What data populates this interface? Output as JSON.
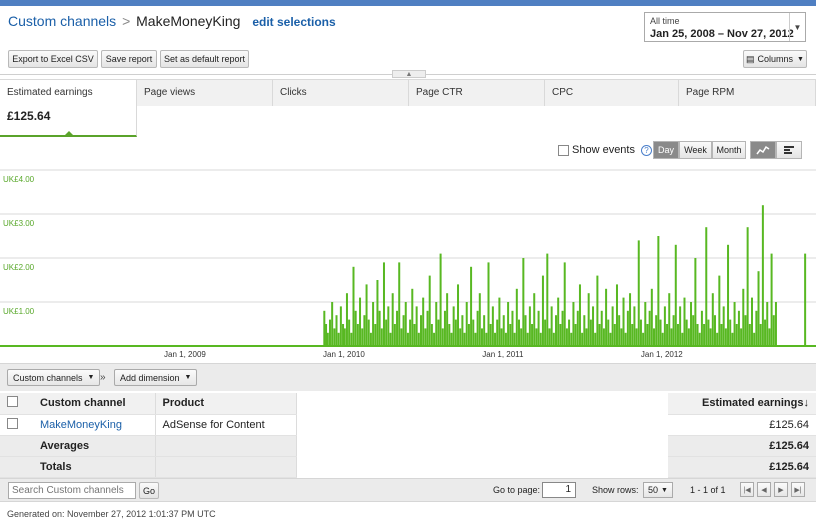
{
  "breadcrumb": {
    "root": "Custom channels",
    "separator": ">",
    "current": "MakeMoneyKing",
    "edit": "edit selections"
  },
  "date_range": {
    "label": "All time",
    "value": "Jan 25, 2008 – Nov 27, 2012"
  },
  "toolbar": {
    "export": "Export to Excel CSV",
    "save": "Save report",
    "default": "Set as default report",
    "columns": "Columns"
  },
  "metrics": [
    {
      "label": "Estimated earnings",
      "value": "£125.64"
    },
    {
      "label": "Page views",
      "value": ""
    },
    {
      "label": "Clicks",
      "value": ""
    },
    {
      "label": "Page CTR",
      "value": ""
    },
    {
      "label": "CPC",
      "value": ""
    },
    {
      "label": "Page RPM",
      "value": ""
    }
  ],
  "chart_controls": {
    "show_events": "Show events",
    "help": "?",
    "granularity": [
      "Day",
      "Week",
      "Month"
    ],
    "selected_granularity": "Day"
  },
  "chart_data": {
    "type": "bar",
    "y_ticks": [
      "UK£4.00",
      "UK£3.00",
      "UK£2.00",
      "UK£1.00"
    ],
    "ylim": [
      0,
      4
    ],
    "x_ticks": [
      "Jan 1, 2009",
      "Jan 1, 2010",
      "Jan 1, 2011",
      "Jan 1, 2012"
    ],
    "x_range": [
      "2008-01-25",
      "2012-11-27"
    ],
    "grid": true,
    "series": [
      {
        "color": "#58b822",
        "points": [
          [
            "2009-11-17",
            0.8
          ],
          [
            "2009-11-21",
            0.5
          ],
          [
            "2009-11-25",
            0.3
          ],
          [
            "2009-11-30",
            0.6
          ],
          [
            "2009-12-05",
            1.0
          ],
          [
            "2009-12-10",
            0.4
          ],
          [
            "2009-12-15",
            0.7
          ],
          [
            "2009-12-20",
            0.3
          ],
          [
            "2009-12-25",
            0.9
          ],
          [
            "2009-12-30",
            0.5
          ],
          [
            "2010-01-03",
            0.4
          ],
          [
            "2010-01-08",
            1.2
          ],
          [
            "2010-01-13",
            0.6
          ],
          [
            "2010-01-18",
            0.3
          ],
          [
            "2010-01-23",
            1.8
          ],
          [
            "2010-01-28",
            0.8
          ],
          [
            "2010-02-02",
            0.5
          ],
          [
            "2010-02-07",
            1.1
          ],
          [
            "2010-02-12",
            0.4
          ],
          [
            "2010-02-17",
            0.7
          ],
          [
            "2010-02-22",
            1.4
          ],
          [
            "2010-02-27",
            0.6
          ],
          [
            "2010-03-04",
            0.3
          ],
          [
            "2010-03-09",
            1.0
          ],
          [
            "2010-03-14",
            0.5
          ],
          [
            "2010-03-19",
            1.5
          ],
          [
            "2010-03-24",
            0.8
          ],
          [
            "2010-03-29",
            0.4
          ],
          [
            "2010-04-03",
            1.9
          ],
          [
            "2010-04-08",
            0.6
          ],
          [
            "2010-04-13",
            0.9
          ],
          [
            "2010-04-18",
            0.3
          ],
          [
            "2010-04-23",
            1.2
          ],
          [
            "2010-04-28",
            0.5
          ],
          [
            "2010-05-03",
            0.8
          ],
          [
            "2010-05-08",
            1.9
          ],
          [
            "2010-05-13",
            0.4
          ],
          [
            "2010-05-18",
            0.7
          ],
          [
            "2010-05-23",
            1.0
          ],
          [
            "2010-05-28",
            0.3
          ],
          [
            "2010-06-02",
            0.6
          ],
          [
            "2010-06-07",
            1.3
          ],
          [
            "2010-06-12",
            0.5
          ],
          [
            "2010-06-17",
            0.9
          ],
          [
            "2010-06-22",
            0.3
          ],
          [
            "2010-06-27",
            0.7
          ],
          [
            "2010-07-02",
            1.1
          ],
          [
            "2010-07-07",
            0.4
          ],
          [
            "2010-07-12",
            0.8
          ],
          [
            "2010-07-17",
            1.6
          ],
          [
            "2010-07-22",
            0.5
          ],
          [
            "2010-07-27",
            0.3
          ],
          [
            "2010-08-01",
            1.0
          ],
          [
            "2010-08-06",
            0.6
          ],
          [
            "2010-08-11",
            2.1
          ],
          [
            "2010-08-16",
            0.4
          ],
          [
            "2010-08-21",
            0.8
          ],
          [
            "2010-08-26",
            1.2
          ],
          [
            "2010-08-31",
            0.5
          ],
          [
            "2010-09-05",
            0.3
          ],
          [
            "2010-09-10",
            0.9
          ],
          [
            "2010-09-15",
            0.6
          ],
          [
            "2010-09-20",
            1.4
          ],
          [
            "2010-09-25",
            0.4
          ],
          [
            "2010-09-30",
            0.7
          ],
          [
            "2010-10-05",
            0.3
          ],
          [
            "2010-10-10",
            1.0
          ],
          [
            "2010-10-15",
            0.5
          ],
          [
            "2010-10-20",
            1.8
          ],
          [
            "2010-10-25",
            0.6
          ],
          [
            "2010-10-30",
            0.3
          ],
          [
            "2010-11-04",
            0.8
          ],
          [
            "2010-11-09",
            1.2
          ],
          [
            "2010-11-14",
            0.4
          ],
          [
            "2010-11-19",
            0.7
          ],
          [
            "2010-11-24",
            0.3
          ],
          [
            "2010-11-29",
            1.9
          ],
          [
            "2010-12-04",
            0.5
          ],
          [
            "2010-12-09",
            0.9
          ],
          [
            "2010-12-14",
            0.3
          ],
          [
            "2010-12-19",
            0.6
          ],
          [
            "2010-12-24",
            1.1
          ],
          [
            "2010-12-29",
            0.4
          ],
          [
            "2011-01-03",
            0.7
          ],
          [
            "2011-01-08",
            0.3
          ],
          [
            "2011-01-13",
            1.0
          ],
          [
            "2011-01-18",
            0.5
          ],
          [
            "2011-01-23",
            0.8
          ],
          [
            "2011-01-28",
            0.3
          ],
          [
            "2011-02-02",
            1.3
          ],
          [
            "2011-02-07",
            0.6
          ],
          [
            "2011-02-12",
            0.4
          ],
          [
            "2011-02-17",
            2.0
          ],
          [
            "2011-02-22",
            0.7
          ],
          [
            "2011-02-27",
            0.3
          ],
          [
            "2011-03-04",
            0.9
          ],
          [
            "2011-03-09",
            0.5
          ],
          [
            "2011-03-14",
            1.2
          ],
          [
            "2011-03-19",
            0.4
          ],
          [
            "2011-03-24",
            0.8
          ],
          [
            "2011-03-29",
            0.3
          ],
          [
            "2011-04-03",
            1.6
          ],
          [
            "2011-04-08",
            0.6
          ],
          [
            "2011-04-13",
            2.1
          ],
          [
            "2011-04-18",
            0.4
          ],
          [
            "2011-04-23",
            0.9
          ],
          [
            "2011-04-28",
            0.3
          ],
          [
            "2011-05-03",
            0.7
          ],
          [
            "2011-05-08",
            1.1
          ],
          [
            "2011-05-13",
            0.5
          ],
          [
            "2011-05-18",
            0.8
          ],
          [
            "2011-05-23",
            1.9
          ],
          [
            "2011-05-28",
            0.4
          ],
          [
            "2011-06-02",
            0.6
          ],
          [
            "2011-06-07",
            0.3
          ],
          [
            "2011-06-12",
            1.0
          ],
          [
            "2011-06-17",
            0.5
          ],
          [
            "2011-06-22",
            0.8
          ],
          [
            "2011-06-27",
            1.4
          ],
          [
            "2011-07-02",
            0.3
          ],
          [
            "2011-07-07",
            0.7
          ],
          [
            "2011-07-12",
            0.4
          ],
          [
            "2011-07-17",
            1.2
          ],
          [
            "2011-07-22",
            0.6
          ],
          [
            "2011-07-27",
            0.9
          ],
          [
            "2011-08-01",
            0.3
          ],
          [
            "2011-08-06",
            1.6
          ],
          [
            "2011-08-11",
            0.5
          ],
          [
            "2011-08-16",
            0.8
          ],
          [
            "2011-08-21",
            0.4
          ],
          [
            "2011-08-26",
            1.3
          ],
          [
            "2011-08-31",
            0.6
          ],
          [
            "2011-09-05",
            0.3
          ],
          [
            "2011-09-10",
            0.9
          ],
          [
            "2011-09-15",
            0.5
          ],
          [
            "2011-09-20",
            1.4
          ],
          [
            "2011-09-25",
            0.7
          ],
          [
            "2011-09-30",
            0.4
          ],
          [
            "2011-10-05",
            1.1
          ],
          [
            "2011-10-10",
            0.3
          ],
          [
            "2011-10-15",
            0.8
          ],
          [
            "2011-10-20",
            1.2
          ],
          [
            "2011-10-25",
            0.5
          ],
          [
            "2011-10-30",
            0.9
          ],
          [
            "2011-11-04",
            0.4
          ],
          [
            "2011-11-09",
            2.4
          ],
          [
            "2011-11-14",
            0.6
          ],
          [
            "2011-11-19",
            0.3
          ],
          [
            "2011-11-24",
            1.0
          ],
          [
            "2011-11-29",
            0.5
          ],
          [
            "2011-12-04",
            0.8
          ],
          [
            "2011-12-09",
            1.3
          ],
          [
            "2011-12-14",
            0.4
          ],
          [
            "2011-12-19",
            0.7
          ],
          [
            "2011-12-24",
            2.5
          ],
          [
            "2011-12-29",
            0.6
          ],
          [
            "2012-01-03",
            0.3
          ],
          [
            "2012-01-08",
            0.9
          ],
          [
            "2012-01-13",
            0.5
          ],
          [
            "2012-01-18",
            1.2
          ],
          [
            "2012-01-23",
            0.4
          ],
          [
            "2012-01-28",
            0.7
          ],
          [
            "2012-02-02",
            2.3
          ],
          [
            "2012-02-07",
            0.5
          ],
          [
            "2012-02-12",
            0.9
          ],
          [
            "2012-02-17",
            0.3
          ],
          [
            "2012-02-22",
            1.1
          ],
          [
            "2012-02-27",
            0.6
          ],
          [
            "2012-03-03",
            0.4
          ],
          [
            "2012-03-08",
            1.0
          ],
          [
            "2012-03-13",
            0.7
          ],
          [
            "2012-03-18",
            2.0
          ],
          [
            "2012-03-23",
            0.5
          ],
          [
            "2012-03-28",
            0.3
          ],
          [
            "2012-04-02",
            0.8
          ],
          [
            "2012-04-07",
            0.5
          ],
          [
            "2012-04-12",
            2.7
          ],
          [
            "2012-04-17",
            0.6
          ],
          [
            "2012-04-22",
            0.4
          ],
          [
            "2012-04-27",
            1.2
          ],
          [
            "2012-05-02",
            0.7
          ],
          [
            "2012-05-07",
            0.3
          ],
          [
            "2012-05-12",
            1.6
          ],
          [
            "2012-05-17",
            0.5
          ],
          [
            "2012-05-22",
            0.9
          ],
          [
            "2012-05-27",
            0.4
          ],
          [
            "2012-06-01",
            2.3
          ],
          [
            "2012-06-06",
            0.6
          ],
          [
            "2012-06-11",
            0.3
          ],
          [
            "2012-06-16",
            1.0
          ],
          [
            "2012-06-21",
            0.5
          ],
          [
            "2012-06-26",
            0.8
          ],
          [
            "2012-07-01",
            0.4
          ],
          [
            "2012-07-06",
            1.3
          ],
          [
            "2012-07-11",
            0.7
          ],
          [
            "2012-07-16",
            2.7
          ],
          [
            "2012-07-21",
            0.5
          ],
          [
            "2012-07-26",
            1.1
          ],
          [
            "2012-07-31",
            0.3
          ],
          [
            "2012-08-05",
            0.8
          ],
          [
            "2012-08-10",
            1.7
          ],
          [
            "2012-08-15",
            0.5
          ],
          [
            "2012-08-20",
            3.2
          ],
          [
            "2012-08-25",
            0.6
          ],
          [
            "2012-08-30",
            1.0
          ],
          [
            "2012-09-04",
            0.4
          ],
          [
            "2012-09-09",
            2.1
          ],
          [
            "2012-09-14",
            0.7
          ],
          [
            "2012-09-19",
            1.0
          ],
          [
            "2012-11-25",
            2.1
          ]
        ]
      }
    ]
  },
  "breakdown": {
    "dimension_button": "Custom channels",
    "chevron": "»",
    "add_dimension": "Add dimension"
  },
  "table": {
    "headers": {
      "channel": "Custom channel",
      "product": "Product",
      "earnings": "Estimated earnings"
    },
    "sort_glyph": "↓",
    "rows": [
      {
        "channel": "MakeMoneyKing",
        "product": "AdSense for Content",
        "earnings": "£125.64"
      }
    ],
    "averages": {
      "label": "Averages",
      "earnings": "£125.64"
    },
    "totals": {
      "label": "Totals",
      "earnings": "£125.64"
    }
  },
  "pager": {
    "search_placeholder": "Search Custom channels",
    "go": "Go",
    "go_to_page_label": "Go to page:",
    "page": "1",
    "show_rows_label": "Show rows:",
    "rows": "50",
    "range": "1 - 1 of 1"
  },
  "footer": {
    "generated": "Generated on: November 27, 2012 1:01:37 PM UTC"
  },
  "icons": {
    "dropdown": "dropdown-arrow-icon",
    "line_chart": "line-chart-icon",
    "bar_chart": "bar-chart-icon",
    "first_page": "first-page-icon",
    "prev_page": "prev-page-icon",
    "next_page": "next-page-icon",
    "last_page": "last-page-icon"
  }
}
